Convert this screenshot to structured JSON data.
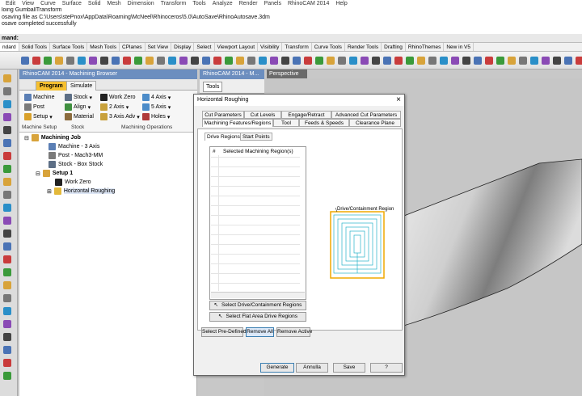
{
  "menu": [
    "Edit",
    "View",
    "Curve",
    "Surface",
    "Solid",
    "Mesh",
    "Dimension",
    "Transform",
    "Tools",
    "Analyze",
    "Render",
    "Panels",
    "RhinoCAM 2014",
    "Help"
  ],
  "command_history": [
    "loing GumballTransform",
    "osaving file as C:\\Users\\stePnox\\AppData\\Roaming\\McNeel\\Rhinoceros\\5.0\\AutoSave\\RhinoAutosave.3dm",
    "osave completed successfully"
  ],
  "command_prompt": "mand:",
  "toolbar_tabs": [
    "ndard",
    "Solid Tools",
    "Surface Tools",
    "Mesh Tools",
    "CPlanes",
    "Set View",
    "Display",
    "Select",
    "Viewport Layout",
    "Visibility",
    "Transform",
    "Curve Tools",
    "Render Tools",
    "Drafting",
    "RhinoThemes",
    "New in V5"
  ],
  "browser": {
    "title": "RhinoCAM 2014 - Machining Browser",
    "tabs": [
      "Program",
      "Simulate"
    ],
    "ribbon": {
      "machine": "Machine",
      "post": "Post",
      "setup": "Setup",
      "stock": "Stock",
      "align": "Align",
      "material": "Material",
      "work_zero": "Work Zero",
      "axis2": "2 Axis",
      "axis3": "3 Axis Adv",
      "axis4": "4 Axis",
      "axis5": "5 Axis",
      "holes": "Holes",
      "group_setup": "Machine Setup",
      "group_stock": "Stock",
      "group_ops": "Machining Operations"
    },
    "tree": {
      "job": "Machining Job",
      "machine": "Machine - 3 Axis",
      "post": "Post - Mach3-MM",
      "stock": "Stock - Box Stock",
      "setup": "Setup 1",
      "workzero": "Work Zero",
      "op": "Horizontal Roughing"
    }
  },
  "tools_panel": {
    "title": "RhinoCAM 2014 - M...",
    "button": "Tools"
  },
  "viewport": {
    "label": "Perspective"
  },
  "dialog": {
    "title": "Horizontal Roughing",
    "close": "×",
    "tabs_row1": [
      "Cut Parameters",
      "Cut Levels",
      "Engage/Retract",
      "Advanced Cut Parameters"
    ],
    "tabs_row2": [
      "Machining Features/Regions",
      "Tool",
      "Feeds & Speeds",
      "Clearance Plane"
    ],
    "subtabs": [
      "Drive Regions",
      "Start Points"
    ],
    "list_headers": {
      "num": "#",
      "name": "Selected Machining Region(s)"
    },
    "buttons": {
      "select_drive": "Select Drive/Containment Regions",
      "select_flat": "Select Flat Area Drive Regions",
      "predefined": "Select Pre-Defined",
      "remove_all": "Remove All",
      "remove_active": "Remove Active"
    },
    "preview_label": "Drive/Containment Region",
    "footer": [
      "Generate",
      "Annulla",
      "Save",
      "?"
    ]
  }
}
